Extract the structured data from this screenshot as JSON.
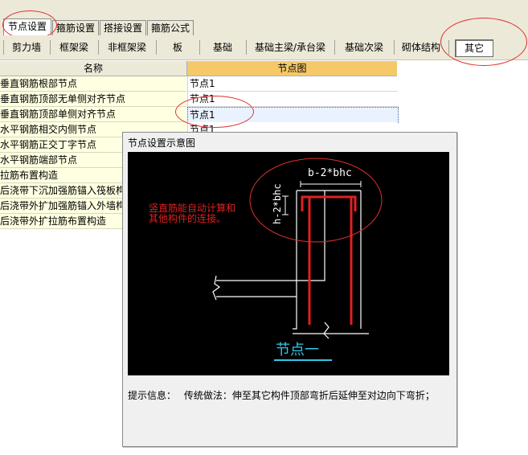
{
  "tabs": [
    {
      "label": "节点设置",
      "active": true
    },
    {
      "label": "箍筋设置",
      "active": false
    },
    {
      "label": "搭接设置",
      "active": false
    },
    {
      "label": "箍筋公式",
      "active": false
    }
  ],
  "categories": [
    {
      "label": "剪力墙"
    },
    {
      "label": "框架梁"
    },
    {
      "label": "非框架梁"
    },
    {
      "label": "板"
    },
    {
      "label": "基础"
    },
    {
      "label": "基础主梁/承台梁"
    },
    {
      "label": "基础次梁"
    },
    {
      "label": "砌体结构"
    },
    {
      "label": "其它",
      "active": true
    }
  ],
  "table": {
    "headers": {
      "name": "名称",
      "node": "节点图"
    },
    "rows": [
      {
        "name": "垂直钢筋根部节点",
        "node": "节点1"
      },
      {
        "name": "垂直钢筋顶部无单侧对齐节点",
        "node": "节点1"
      },
      {
        "name": "垂直钢筋顶部单侧对齐节点",
        "node": "节点1"
      },
      {
        "name": "水平钢筋相交内侧节点",
        "node": "节点1"
      },
      {
        "name": "水平钢筋正交丁字节点",
        "node": ""
      },
      {
        "name": "水平钢筋端部节点",
        "node": ""
      },
      {
        "name": "拉筋布置构造",
        "node": ""
      },
      {
        "name": "后浇带下沉加强筋锚入筏板构造",
        "node": ""
      },
      {
        "name": "后浇带外扩加强筋锚入外墙构造",
        "node": ""
      },
      {
        "name": "后浇带外扩拉筋布置构造",
        "node": ""
      }
    ]
  },
  "dialog": {
    "title": "节点设置示意图",
    "diagram": {
      "dim_top": "b-2*bhc",
      "dim_side": "h-2*bhc",
      "note_line1": "竖直筋能自动计算和",
      "note_line2": "其他构件的连接。",
      "caption": "节点一"
    },
    "tip_label": "提示信息：",
    "tip_text": "传统做法：伸至其它构件顶部弯折后延伸至对边向下弯折；"
  },
  "colors": {
    "annotation_red": "#e03030",
    "rebar_red": "#e02020",
    "caption_cyan": "#30c8e8",
    "header_bg": "#f5c96a",
    "name_bg": "#ffffe1"
  }
}
